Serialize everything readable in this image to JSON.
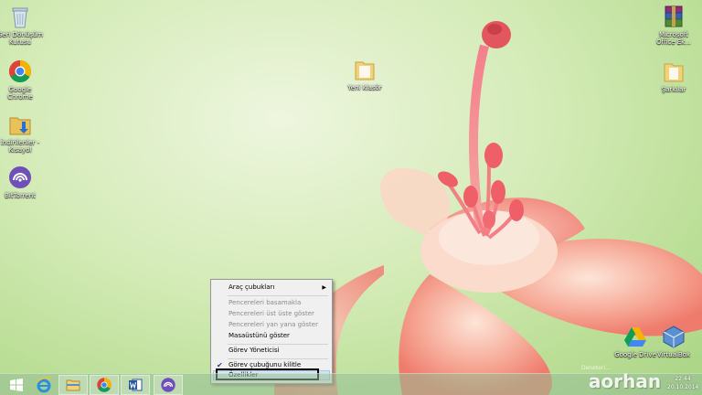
{
  "desktop_icons": [
    {
      "label": "Geri Dönüşüm Kutusu"
    },
    {
      "label": "Google Chrome"
    },
    {
      "label": "İndirilenler - Kısayol"
    },
    {
      "label": "BitTorrent"
    },
    {
      "label": "Yeni klasör"
    },
    {
      "label": "Microsoft Office Ek..."
    },
    {
      "label": "Şarkılar"
    },
    {
      "label": "Google Drive"
    },
    {
      "label": "VirtualBox"
    }
  ],
  "context_menu": {
    "items": [
      {
        "label": "Araç çubukları",
        "has_submenu": true
      },
      {
        "label": "Pencereleri basamakla",
        "disabled": true
      },
      {
        "label": "Pencereleri üst üste göster",
        "disabled": true
      },
      {
        "label": "Pencereleri yan yana göster",
        "disabled": true
      },
      {
        "label": "Masaüstünü göster"
      },
      {
        "label": "Görev Yöneticisi"
      },
      {
        "label": "Görev çubuğunu kilitle",
        "checked": true
      },
      {
        "label": "Özellikler",
        "highlighted": true
      }
    ]
  },
  "taskbar": {
    "apps": [
      "start",
      "internet-explorer",
      "file-explorer",
      "chrome",
      "word",
      "bittorrent"
    ]
  },
  "watermark": {
    "brand": "aorhan",
    "tagline": "Deneteri..."
  },
  "clock": {
    "time": "22:44",
    "date": "20.10.2014"
  },
  "colors": {
    "accent": "#d5e4f4",
    "menu_bg": "#f0f0f0",
    "taskbar": "#96be96"
  }
}
